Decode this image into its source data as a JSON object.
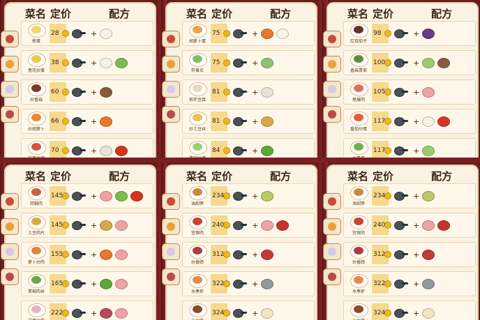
{
  "header": {
    "name": "菜名",
    "price": "定价",
    "recipe": "配方"
  },
  "panels": [
    {
      "rows": [
        {
          "dish": "煎蛋",
          "price": "28",
          "food": "#f2d56b",
          "ings": [
            {
              "icon": "egg-icon",
              "color": "#f7f1e6"
            }
          ]
        },
        {
          "dish": "葱花炒蛋",
          "price": "38",
          "food": "#f0c94b",
          "ings": [
            {
              "icon": "egg-icon",
              "color": "#f7f1e6"
            },
            {
              "icon": "scallion-icon",
              "color": "#7dbb4f"
            }
          ]
        },
        {
          "dish": "炒香菇",
          "price": "60",
          "food": "#7b3a2a",
          "ings": [
            {
              "icon": "mushroom-icon",
              "color": "#8b5a3c"
            }
          ]
        },
        {
          "dish": "炒胡萝卜",
          "price": "66",
          "food": "#e68a2e",
          "ings": [
            {
              "icon": "carrot-icon",
              "color": "#e8782a"
            }
          ]
        },
        {
          "dish": "麻婆豆腐",
          "price": "70",
          "food": "#d1553b",
          "ings": [
            {
              "icon": "tofu-icon",
              "color": "#e7e3d8"
            },
            {
              "icon": "chili-icon",
              "color": "#d7321f"
            }
          ]
        }
      ]
    },
    {
      "rows": [
        {
          "dish": "胡萝卜蛋",
          "price": "75",
          "food": "#eba446",
          "ings": [
            {
              "icon": "carrot-icon",
              "color": "#e8782a"
            },
            {
              "icon": "egg-icon",
              "color": "#f7f1e6"
            }
          ]
        },
        {
          "dish": "拌黄瓜",
          "price": "75",
          "food": "#7cc06b",
          "ings": [
            {
              "icon": "cucumber-icon",
              "color": "#8cc46d"
            }
          ]
        },
        {
          "dish": "煎炸豆腐",
          "price": "81",
          "food": "#e8d9b9",
          "ings": [
            {
              "icon": "tofu-icon",
              "color": "#e7e3d8"
            }
          ]
        },
        {
          "dish": "炒土豆丝",
          "price": "81",
          "food": "#e7c25a",
          "ings": [
            {
              "icon": "potato-icon",
              "color": "#d7a948"
            }
          ]
        },
        {
          "dish": "青椒炒蛋",
          "price": "84",
          "food": "#9fcf6a",
          "ings": [
            {
              "icon": "green-pepper-icon",
              "color": "#5aa93b"
            }
          ]
        }
      ]
    },
    {
      "rows": [
        {
          "dish": "红烧茄子",
          "price": "98",
          "food": "#6a2f2a",
          "ings": [
            {
              "icon": "eggplant-icon",
              "color": "#6b3a8a"
            }
          ]
        },
        {
          "dish": "香菇青菜",
          "price": "100",
          "food": "#5d8f3a",
          "ings": [
            {
              "icon": "cabbage-icon",
              "color": "#9ccc6a"
            },
            {
              "icon": "mushroom-icon",
              "color": "#8b5a3c"
            }
          ]
        },
        {
          "dish": "葱爆肉",
          "price": "105",
          "food": "#d9735a",
          "ings": [
            {
              "icon": "meat-icon",
              "color": "#f0a2a2"
            }
          ]
        },
        {
          "dish": "番茄炒蛋",
          "price": "117",
          "food": "#e6603b",
          "ings": [
            {
              "icon": "egg-icon",
              "color": "#f7f1e6"
            },
            {
              "icon": "tomato-icon",
              "color": "#d8352a"
            }
          ]
        },
        {
          "dish": "炒青菜",
          "price": "117",
          "food": "#6fb24a",
          "ings": [
            {
              "icon": "cabbage-icon",
              "color": "#9ccc6a"
            }
          ]
        }
      ]
    },
    {
      "rows": [
        {
          "dish": "回锅肉",
          "price": "145",
          "food": "#c9623c",
          "ings": [
            {
              "icon": "meat-icon",
              "color": "#f0a2a2"
            },
            {
              "icon": "scallion-icon",
              "color": "#7dbb4f"
            },
            {
              "icon": "chili-icon",
              "color": "#d7321f"
            }
          ]
        },
        {
          "dish": "土豆肉片",
          "price": "145",
          "food": "#d7a948",
          "ings": [
            {
              "icon": "potato-icon",
              "color": "#d7a948"
            },
            {
              "icon": "meat-icon",
              "color": "#f0a2a2"
            }
          ]
        },
        {
          "dish": "萝卜炒肉",
          "price": "155",
          "food": "#e0843a",
          "ings": [
            {
              "icon": "carrot-icon",
              "color": "#e8782a"
            },
            {
              "icon": "meat-icon",
              "color": "#f0a2a2"
            }
          ]
        },
        {
          "dish": "青椒肉丝",
          "price": "165",
          "food": "#6aa84a",
          "ings": [
            {
              "icon": "green-pepper-icon",
              "color": "#5aa93b"
            },
            {
              "icon": "meat-icon",
              "color": "#f0a2a2"
            }
          ]
        },
        {
          "dish": "洋葱炒肉",
          "price": "222",
          "food": "#e8b2c2",
          "ings": [
            {
              "icon": "onion-icon",
              "color": "#b54a5a"
            },
            {
              "icon": "meat-icon",
              "color": "#f0a2a2"
            }
          ]
        }
      ]
    },
    {
      "rows": [
        {
          "dish": "油焖笋",
          "price": "234",
          "food": "#c98a3a",
          "ings": [
            {
              "icon": "bamboo-shoot-icon",
              "color": "#b9c96a"
            }
          ]
        },
        {
          "dish": "宫保肉",
          "price": "240",
          "food": "#c9452e",
          "ings": [
            {
              "icon": "meat-icon",
              "color": "#f0a2a2"
            },
            {
              "icon": "sauce-jar-icon",
              "color": "#c8322a"
            }
          ]
        },
        {
          "dish": "炒香肠",
          "price": "312",
          "food": "#b23a3a",
          "ings": [
            {
              "icon": "sausage-icon",
              "color": "#c23a3a"
            }
          ]
        },
        {
          "dish": "水煮虾",
          "price": "322",
          "food": "#e68a4a",
          "ings": [
            {
              "icon": "shrimp-icon",
              "color": "#8e9a9e"
            }
          ]
        },
        {
          "dish": "小炒鸡",
          "price": "324",
          "food": "#8a4a2a",
          "ings": [
            {
              "icon": "chicken-icon",
              "color": "#f3e4c6"
            }
          ]
        }
      ]
    },
    {
      "rows": [
        {
          "dish": "油焖笋",
          "price": "234",
          "food": "#c98a3a",
          "ings": [
            {
              "icon": "bamboo-shoot-icon",
              "color": "#b9c96a"
            }
          ]
        },
        {
          "dish": "宫保肉",
          "price": "240",
          "food": "#c9452e",
          "ings": [
            {
              "icon": "meat-icon",
              "color": "#f0a2a2"
            },
            {
              "icon": "sauce-jar-icon",
              "color": "#c8322a"
            }
          ]
        },
        {
          "dish": "炒香肠",
          "price": "312",
          "food": "#b23a3a",
          "ings": [
            {
              "icon": "sausage-icon",
              "color": "#c23a3a"
            }
          ]
        },
        {
          "dish": "水煮虾",
          "price": "322",
          "food": "#e68a4a",
          "ings": [
            {
              "icon": "shrimp-icon",
              "color": "#8e9a9e"
            }
          ]
        },
        {
          "dish": "小炒鸡",
          "price": "324",
          "food": "#8a4a2a",
          "ings": [
            {
              "icon": "chicken-icon",
              "color": "#f3e4c6"
            }
          ]
        }
      ]
    }
  ],
  "tab_colors": [
    "#c94b3b",
    "#e8a23a",
    "#d7c9e8",
    "#b94a4a"
  ]
}
